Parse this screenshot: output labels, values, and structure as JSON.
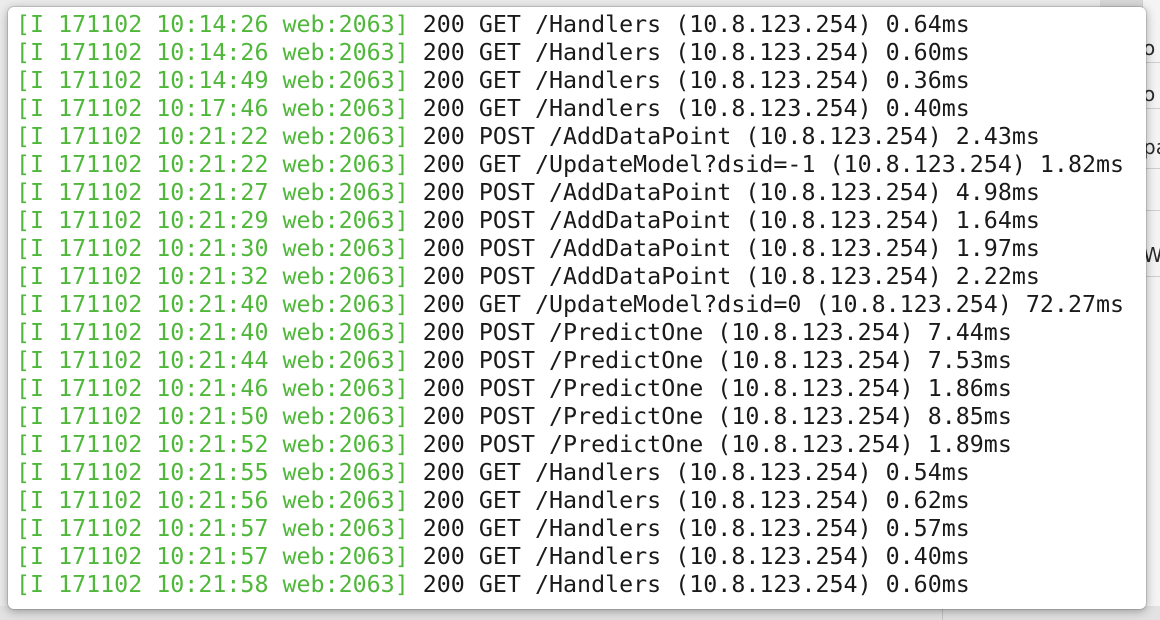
{
  "background": {
    "right_panel_fragments": [
      "o",
      "o",
      "pa",
      "W"
    ]
  },
  "log": {
    "colors": {
      "prefix": "#4fb83a",
      "text": "#1a1a1a"
    },
    "lines": [
      {
        "prefix": "[I 171102 10:14:26 web:2063]",
        "message": " 200 GET /Handlers (10.8.123.254) 0.64ms"
      },
      {
        "prefix": "[I 171102 10:14:26 web:2063]",
        "message": " 200 GET /Handlers (10.8.123.254) 0.60ms"
      },
      {
        "prefix": "[I 171102 10:14:49 web:2063]",
        "message": " 200 GET /Handlers (10.8.123.254) 0.36ms"
      },
      {
        "prefix": "[I 171102 10:17:46 web:2063]",
        "message": " 200 GET /Handlers (10.8.123.254) 0.40ms"
      },
      {
        "prefix": "[I 171102 10:21:22 web:2063]",
        "message": " 200 POST /AddDataPoint (10.8.123.254) 2.43ms"
      },
      {
        "prefix": "[I 171102 10:21:22 web:2063]",
        "message": " 200 GET /UpdateModel?dsid=-1 (10.8.123.254) 1.82ms"
      },
      {
        "prefix": "[I 171102 10:21:27 web:2063]",
        "message": " 200 POST /AddDataPoint (10.8.123.254) 4.98ms"
      },
      {
        "prefix": "[I 171102 10:21:29 web:2063]",
        "message": " 200 POST /AddDataPoint (10.8.123.254) 1.64ms"
      },
      {
        "prefix": "[I 171102 10:21:30 web:2063]",
        "message": " 200 POST /AddDataPoint (10.8.123.254) 1.97ms"
      },
      {
        "prefix": "[I 171102 10:21:32 web:2063]",
        "message": " 200 POST /AddDataPoint (10.8.123.254) 2.22ms"
      },
      {
        "prefix": "[I 171102 10:21:40 web:2063]",
        "message": " 200 GET /UpdateModel?dsid=0 (10.8.123.254) 72.27ms"
      },
      {
        "prefix": "[I 171102 10:21:40 web:2063]",
        "message": " 200 POST /PredictOne (10.8.123.254) 7.44ms"
      },
      {
        "prefix": "[I 171102 10:21:44 web:2063]",
        "message": " 200 POST /PredictOne (10.8.123.254) 7.53ms"
      },
      {
        "prefix": "[I 171102 10:21:46 web:2063]",
        "message": " 200 POST /PredictOne (10.8.123.254) 1.86ms"
      },
      {
        "prefix": "[I 171102 10:21:50 web:2063]",
        "message": " 200 POST /PredictOne (10.8.123.254) 8.85ms"
      },
      {
        "prefix": "[I 171102 10:21:52 web:2063]",
        "message": " 200 POST /PredictOne (10.8.123.254) 1.89ms"
      },
      {
        "prefix": "[I 171102 10:21:55 web:2063]",
        "message": " 200 GET /Handlers (10.8.123.254) 0.54ms"
      },
      {
        "prefix": "[I 171102 10:21:56 web:2063]",
        "message": " 200 GET /Handlers (10.8.123.254) 0.62ms"
      },
      {
        "prefix": "[I 171102 10:21:57 web:2063]",
        "message": " 200 GET /Handlers (10.8.123.254) 0.57ms"
      },
      {
        "prefix": "[I 171102 10:21:57 web:2063]",
        "message": " 200 GET /Handlers (10.8.123.254) 0.40ms"
      },
      {
        "prefix": "[I 171102 10:21:58 web:2063]",
        "message": " 200 GET /Handlers (10.8.123.254) 0.60ms"
      }
    ]
  }
}
